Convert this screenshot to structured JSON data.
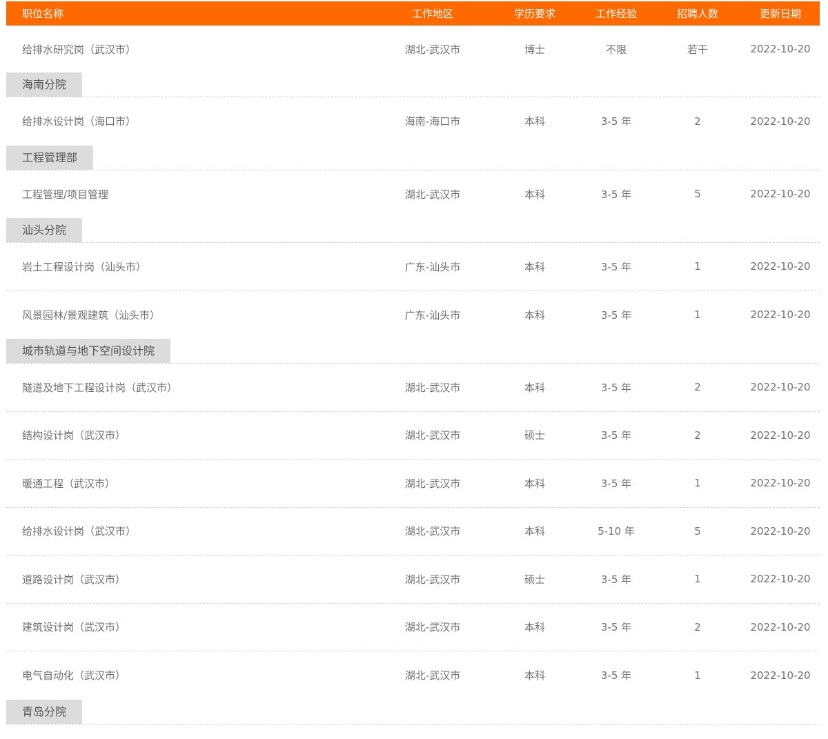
{
  "header": {
    "title": "职位名称",
    "location": "工作地区",
    "education": "学历要求",
    "experience": "工作经验",
    "openings": "招聘人数",
    "updated": "更新日期"
  },
  "sections": [
    {
      "group": "",
      "jobs": [
        {
          "title": "给排水研究岗（武汉市）",
          "location": "湖北-武汉市",
          "education": "博士",
          "experience": "不限",
          "openings": "若干",
          "updated": "2022-10-20"
        }
      ]
    },
    {
      "group": "海南分院",
      "jobs": [
        {
          "title": "给排水设计岗（海口市）",
          "location": "海南-海口市",
          "education": "本科",
          "experience": "3-5 年",
          "openings": "2",
          "updated": "2022-10-20"
        }
      ]
    },
    {
      "group": "工程管理部",
      "jobs": [
        {
          "title": "工程管理/项目管理",
          "location": "湖北-武汉市",
          "education": "本科",
          "experience": "3-5 年",
          "openings": "5",
          "updated": "2022-10-20"
        }
      ]
    },
    {
      "group": "汕头分院",
      "jobs": [
        {
          "title": "岩土工程设计岗（汕头市）",
          "location": "广东-汕头市",
          "education": "本科",
          "experience": "3-5 年",
          "openings": "1",
          "updated": "2022-10-20"
        },
        {
          "title": "风景园林/景观建筑（汕头市）",
          "location": "广东-汕头市",
          "education": "本科",
          "experience": "3-5 年",
          "openings": "1",
          "updated": "2022-10-20"
        }
      ]
    },
    {
      "group": "城市轨道与地下空间设计院",
      "jobs": [
        {
          "title": "隧道及地下工程设计岗（武汉市）",
          "location": "湖北-武汉市",
          "education": "本科",
          "experience": "3-5 年",
          "openings": "2",
          "updated": "2022-10-20"
        },
        {
          "title": "结构设计岗（武汉市）",
          "location": "湖北-武汉市",
          "education": "硕士",
          "experience": "3-5 年",
          "openings": "2",
          "updated": "2022-10-20"
        },
        {
          "title": "暖通工程（武汉市）",
          "location": "湖北-武汉市",
          "education": "本科",
          "experience": "3-5 年",
          "openings": "1",
          "updated": "2022-10-20"
        },
        {
          "title": "给排水设计岗（武汉市）",
          "location": "湖北-武汉市",
          "education": "本科",
          "experience": "5-10 年",
          "openings": "5",
          "updated": "2022-10-20"
        },
        {
          "title": "道路设计岗（武汉市）",
          "location": "湖北-武汉市",
          "education": "硕士",
          "experience": "3-5 年",
          "openings": "1",
          "updated": "2022-10-20"
        },
        {
          "title": "建筑设计岗（武汉市）",
          "location": "湖北-武汉市",
          "education": "本科",
          "experience": "3-5 年",
          "openings": "2",
          "updated": "2022-10-20"
        },
        {
          "title": "电气自动化（武汉市）",
          "location": "湖北-武汉市",
          "education": "本科",
          "experience": "3-5 年",
          "openings": "1",
          "updated": "2022-10-20"
        }
      ]
    },
    {
      "group": "青岛分院",
      "jobs": []
    }
  ]
}
